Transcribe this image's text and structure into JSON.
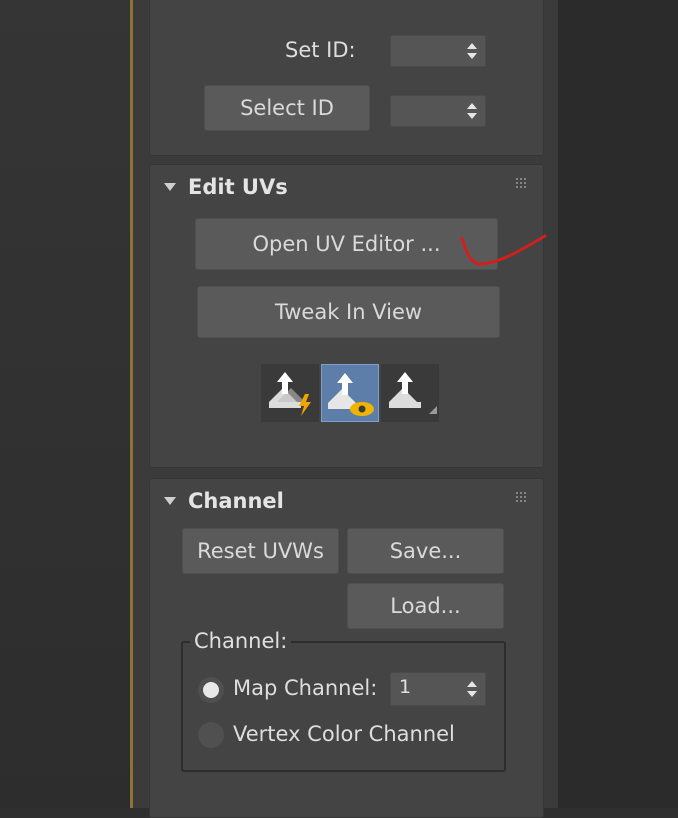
{
  "modifier_panel": {
    "selection_rollout": {
      "set_id_label": "Set ID:",
      "set_id_value": "",
      "select_id_button": "Select ID",
      "select_id_value": ""
    },
    "edit_uvs_rollout": {
      "title": "Edit UVs",
      "open_uv_editor_button": "Open UV Editor ...",
      "tweak_in_view_button": "Tweak In View",
      "tool_icons": [
        "peel-lightning-icon",
        "peel-eye-icon",
        "peel-icon"
      ],
      "active_tool_index": 1
    },
    "channel_rollout": {
      "title": "Channel",
      "reset_uvws_button": "Reset UVWs",
      "save_button": "Save...",
      "load_button": "Load...",
      "channel_group_label": "Channel:",
      "map_channel_label": "Map Channel:",
      "map_channel_value": "1",
      "vertex_color_channel_label": "Vertex Color Channel",
      "selected_channel": "map"
    }
  },
  "colors": {
    "active_button": "#5d7ea8",
    "annotation_red": "#d11f1f",
    "frame_accent": "#8e7336"
  }
}
